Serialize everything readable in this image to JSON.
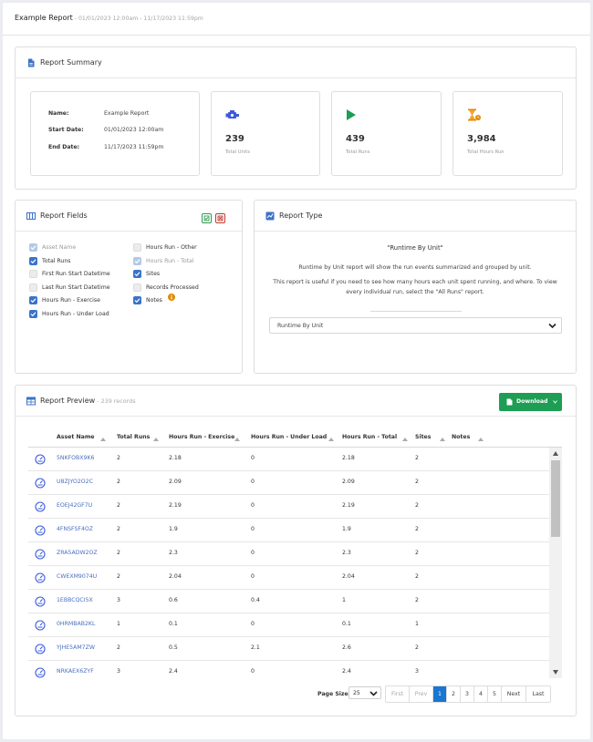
{
  "header": {
    "title": "Example Report",
    "subtitle": " - 01/01/2023 12:00am - 11/17/2023 11:59pm"
  },
  "summary": {
    "title": "Report Summary",
    "name_label": "Name:",
    "name_value": "Example Report",
    "start_label": "Start Date:",
    "start_value": "01/01/2023 12:00am",
    "end_label": "End Date:",
    "end_value": "11/17/2023 11:59pm",
    "stats": [
      {
        "icon": "engine-icon",
        "value": "239",
        "label": "Total Units",
        "color": "#3b5bdb"
      },
      {
        "icon": "play-icon",
        "value": "439",
        "label": "Total Runs",
        "color": "#1e9d55"
      },
      {
        "icon": "hourglass-icon",
        "value": "3,984",
        "label": "Total Hours Run",
        "color": "#e08a00"
      }
    ]
  },
  "fields": {
    "title": "Report Fields",
    "left": [
      {
        "label": "Asset Name",
        "state": "disabled"
      },
      {
        "label": "Total Runs",
        "state": "checked"
      },
      {
        "label": "First Run Start Datetime",
        "state": "unchecked"
      },
      {
        "label": "Last Run Start Datetime",
        "state": "unchecked"
      },
      {
        "label": "Hours Run - Exercise",
        "state": "checked"
      },
      {
        "label": "Hours Run - Under Load",
        "state": "checked"
      }
    ],
    "right": [
      {
        "label": "Hours Run - Other",
        "state": "unchecked"
      },
      {
        "label": "Hours Run - Total",
        "state": "disabled"
      },
      {
        "label": "Sites",
        "state": "checked"
      },
      {
        "label": "Records Processed",
        "state": "unchecked"
      },
      {
        "label": "Notes",
        "state": "checked"
      }
    ]
  },
  "report_type": {
    "title": "Report Type",
    "heading": "\"Runtime By Unit\"",
    "desc1": "Runtime by Unit report will show the run events summarized and grouped by unit.",
    "desc2": "This report is useful if you need to see how many hours each unit spent running, and where. To view",
    "desc3": "every individual run, select the \"All Runs\" report.",
    "selected": "Runtime By Unit"
  },
  "preview": {
    "title": "Report Preview",
    "count": " - 239 records",
    "download_label": "Download",
    "columns": [
      "Asset Name",
      "Total Runs",
      "Hours Run - Exercise",
      "Hours Run - Under Load",
      "Hours Run - Total",
      "Sites",
      "Notes"
    ],
    "rows": [
      [
        "5NKFOBX9K6",
        "2",
        "2.18",
        "0",
        "2.18",
        "2",
        ""
      ],
      [
        "U8ZJYO2O2C",
        "2",
        "2.09",
        "0",
        "2.09",
        "2",
        ""
      ],
      [
        "EOEJ42GF7U",
        "2",
        "2.19",
        "0",
        "2.19",
        "2",
        ""
      ],
      [
        "4FNSFSF4OZ",
        "2",
        "1.9",
        "0",
        "1.9",
        "2",
        ""
      ],
      [
        "ZRA5ADW2OZ",
        "2",
        "2.3",
        "0",
        "2.3",
        "2",
        ""
      ],
      [
        "CWEXM9074U",
        "2",
        "2.04",
        "0",
        "2.04",
        "2",
        ""
      ],
      [
        "1EBBCQCI5X",
        "3",
        "0.6",
        "0.4",
        "1",
        "2",
        ""
      ],
      [
        "0HRMBAB2KL",
        "1",
        "0.1",
        "0",
        "0.1",
        "1",
        ""
      ],
      [
        "YJHE5AM7ZW",
        "2",
        "0.5",
        "2.1",
        "2.6",
        "2",
        ""
      ],
      [
        "NRKAEX6ZYF",
        "3",
        "2.4",
        "0",
        "2.4",
        "3",
        ""
      ]
    ],
    "page_size_label": "Page Size",
    "page_size": "25",
    "pager": [
      "First",
      "Prev",
      "1",
      "2",
      "3",
      "4",
      "5",
      "Next",
      "Last"
    ],
    "active_page": "1"
  }
}
